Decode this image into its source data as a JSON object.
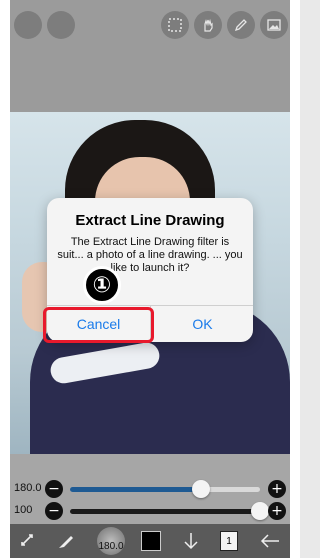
{
  "dialog": {
    "title": "Extract Line Drawing",
    "message": "The Extract Line Drawing filter is suit... a photo of a line drawing. ... you like to launch it?",
    "cancel_label": "Cancel",
    "ok_label": "OK"
  },
  "annotation": {
    "step_badge": "①",
    "highlight_color": "#e8192c"
  },
  "sliders": [
    {
      "label": "180.0",
      "value": 180.0,
      "fill_fraction": 0.69,
      "fill_color": "#1e5a93"
    },
    {
      "label": "100",
      "value": 100,
      "fill_fraction": 1.0,
      "fill_color": "#1a1a1a"
    }
  ],
  "slider_buttons": {
    "minus": "−",
    "plus": "+"
  },
  "bottom_toolbar": {
    "brush_size_label": "180.0",
    "layer_number": "1",
    "color": "#000000"
  },
  "top_toolbar": {
    "icons": [
      "circle-button",
      "circle-button",
      "selection-icon",
      "hand-icon",
      "pen-icon",
      "image-icon"
    ]
  },
  "colors": {
    "toolbar_gray": "#9b9b9b",
    "dialog_button_blue": "#1a7bea"
  }
}
